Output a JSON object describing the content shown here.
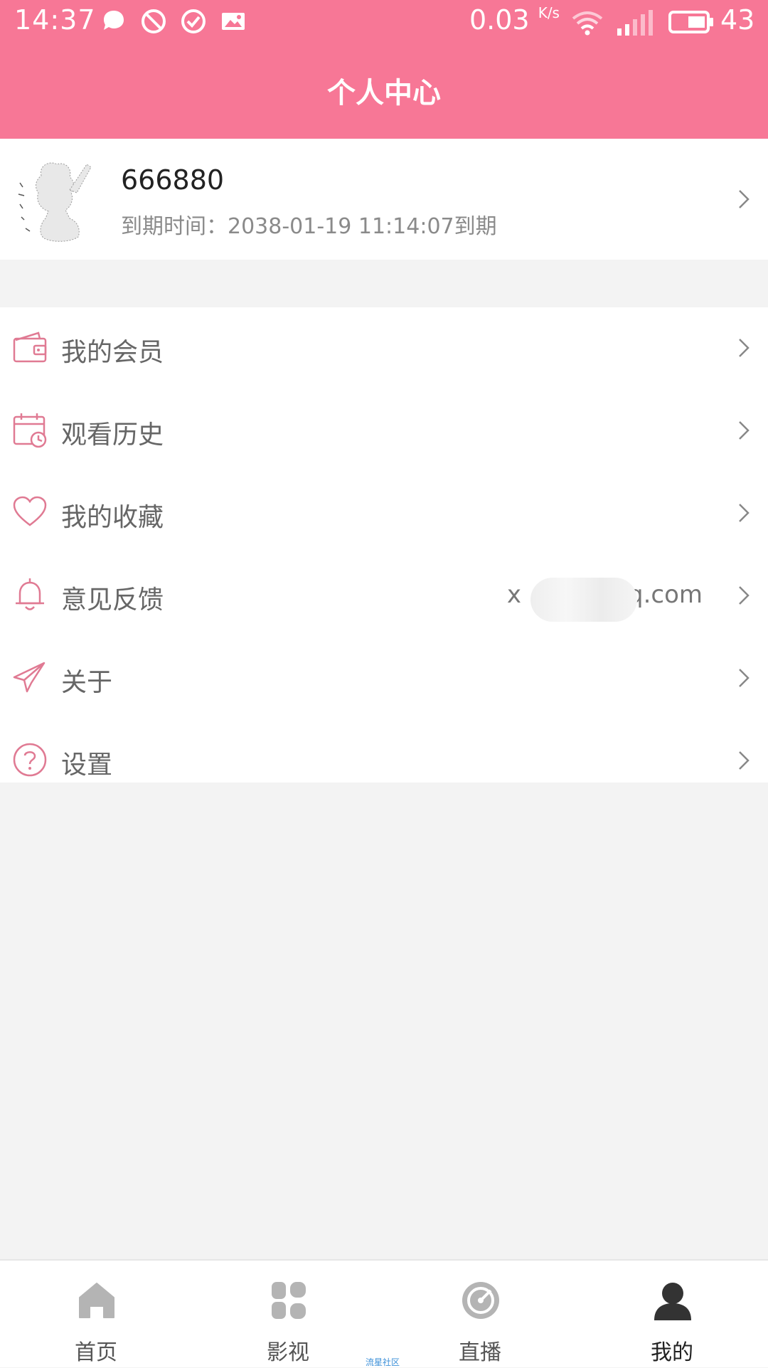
{
  "status_bar": {
    "time": "14:37",
    "speed": "0.03",
    "speed_unit": "K/s",
    "battery": "43",
    "icons": [
      "chat-bubble-icon",
      "block-icon",
      "check-circle-icon",
      "image-icon",
      "wifi-icon",
      "signal-icon",
      "battery-icon"
    ]
  },
  "header": {
    "title": "个人中心"
  },
  "profile": {
    "name": "666880",
    "expire": "到期时间：2038-01-19 11:14:07到期"
  },
  "menu": {
    "items": [
      {
        "label": "我的会员",
        "icon": "wallet-icon"
      },
      {
        "label": "观看历史",
        "icon": "calendar-clock-icon"
      },
      {
        "label": "我的收藏",
        "icon": "heart-icon"
      },
      {
        "label": "意见反馈",
        "icon": "bell-icon",
        "value_prefix": "x",
        "value_suffix": "q.com"
      },
      {
        "label": "关于",
        "icon": "paper-plane-icon"
      },
      {
        "label": "设置",
        "icon": "question-circle-icon"
      }
    ]
  },
  "tabbar": {
    "tabs": [
      {
        "label": "首页",
        "icon": "home-icon"
      },
      {
        "label": "影视",
        "icon": "grid-icon"
      },
      {
        "label": "直播",
        "icon": "radar-icon"
      },
      {
        "label": "我的",
        "icon": "user-icon",
        "active": true
      }
    ]
  },
  "watermark": "流星社区",
  "colors": {
    "accent": "#f77796",
    "icon_pink": "#e07a93",
    "background": "#f3f3f3"
  }
}
